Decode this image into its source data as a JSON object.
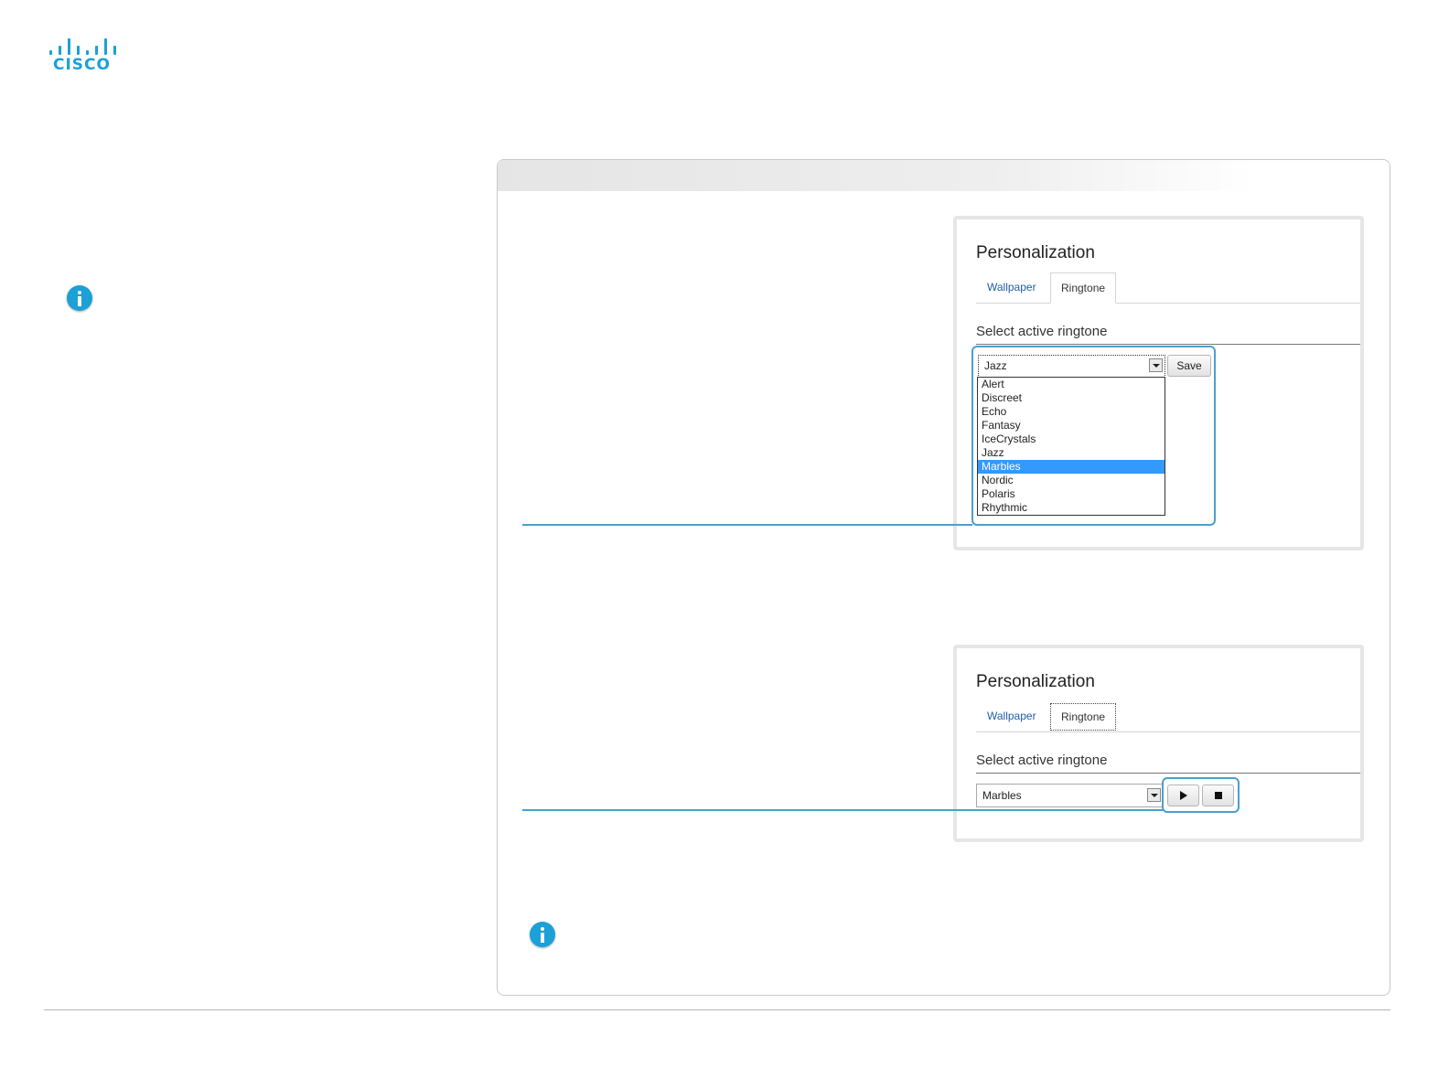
{
  "brand": {
    "logo_text": "CISCO",
    "accent_color": "#1ba0d7"
  },
  "callout_color": "#4a9fd0",
  "screenshot_1": {
    "title": "Personalization",
    "tabs": [
      "Wallpaper",
      "Ringtone"
    ],
    "active_tab": "Ringtone",
    "section_title": "Select active ringtone",
    "select_value": "Jazz",
    "options": [
      "Alert",
      "Discreet",
      "Echo",
      "Fantasy",
      "IceCrystals",
      "Jazz",
      "Marbles",
      "Nordic",
      "Polaris",
      "Rhythmic"
    ],
    "highlighted_option": "Marbles",
    "save_label": "Save"
  },
  "screenshot_2": {
    "title": "Personalization",
    "tabs": [
      "Wallpaper",
      "Ringtone"
    ],
    "active_tab": "Ringtone",
    "section_title": "Select active ringtone",
    "select_value": "Marbles",
    "play_icon": "play-icon",
    "stop_icon": "stop-icon"
  },
  "icons": {
    "info": "info-icon"
  }
}
